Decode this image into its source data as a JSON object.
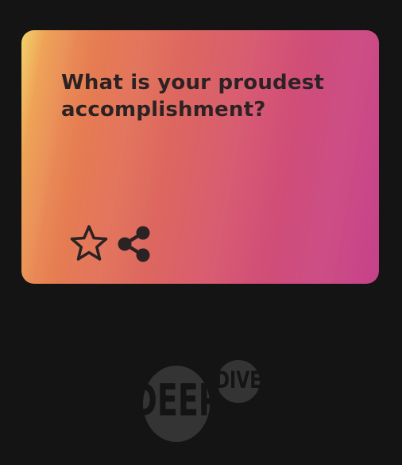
{
  "card": {
    "question": "What is your proudest accomplishment?",
    "gradient_colors": [
      "#f2cf62",
      "#e8834f",
      "#dc6462",
      "#c6418a"
    ],
    "text_color": "#2b2224"
  },
  "actions": {
    "favorite_icon": "star-outline-icon",
    "share_icon": "share-icon"
  },
  "logo": {
    "word_1": "DEEP",
    "word_2": "DIVE",
    "color": "#3a3a3a"
  },
  "page_background": "#141414"
}
